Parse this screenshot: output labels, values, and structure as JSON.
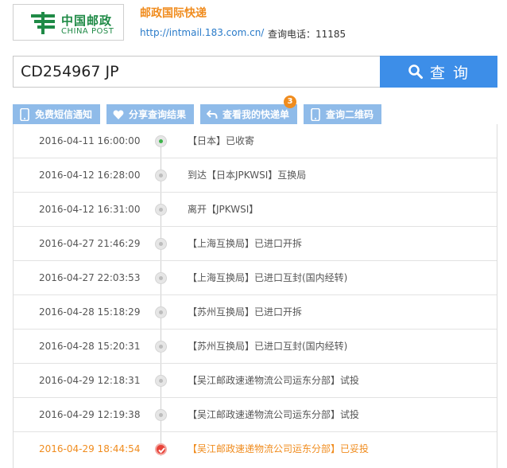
{
  "header": {
    "logo_cn": "中国邮政",
    "logo_en": "CHINA POST",
    "title": "邮政国际快递",
    "url": "http://intmail.183.com.cn/",
    "tel": "查询电话：11185"
  },
  "search": {
    "value": "CD254967   JP",
    "button_label": "查 询"
  },
  "tabs": [
    {
      "label": "免费短信通知",
      "icon": "phone-icon"
    },
    {
      "label": "分享查询结果",
      "icon": "heart-icon"
    },
    {
      "label": "查看我的快递单",
      "icon": "return-arrow-icon",
      "badge": "3"
    },
    {
      "label": "查询二维码",
      "icon": "phone-icon"
    }
  ],
  "colors": {
    "accent_blue": "#3d8ee8",
    "tab_blue": "#8fbbe9",
    "orange": "#f08c1e",
    "green": "#3db34a",
    "delivered_red": "#e8443a"
  },
  "events": [
    {
      "time": "2016-04-11 16:00:00",
      "desc": "【日本】已收寄",
      "status": "start"
    },
    {
      "time": "2016-04-12 16:28:00",
      "desc": "到达【日本JPKWSI】互换局",
      "status": "normal"
    },
    {
      "time": "2016-04-12 16:31:00",
      "desc": "离开【JPKWSI】",
      "status": "normal"
    },
    {
      "time": "2016-04-27 21:46:29",
      "desc": "【上海互换局】已进口开拆",
      "status": "normal"
    },
    {
      "time": "2016-04-27 22:03:53",
      "desc": "【上海互换局】已进口互封(国内经转)",
      "status": "normal"
    },
    {
      "time": "2016-04-28 15:18:29",
      "desc": "【苏州互换局】已进口开拆",
      "status": "normal"
    },
    {
      "time": "2016-04-28 15:20:31",
      "desc": "【苏州互换局】已进口互封(国内经转)",
      "status": "normal"
    },
    {
      "time": "2016-04-29 12:18:31",
      "desc": "【吴江邮政速递物流公司运东分部】试投",
      "status": "normal"
    },
    {
      "time": "2016-04-29 12:19:38",
      "desc": "【吴江邮政速递物流公司运东分部】试投",
      "status": "normal"
    },
    {
      "time": "2016-04-29 18:44:54",
      "desc": "【吴江邮政速递物流公司运东分部】已妥投",
      "status": "delivered"
    }
  ]
}
